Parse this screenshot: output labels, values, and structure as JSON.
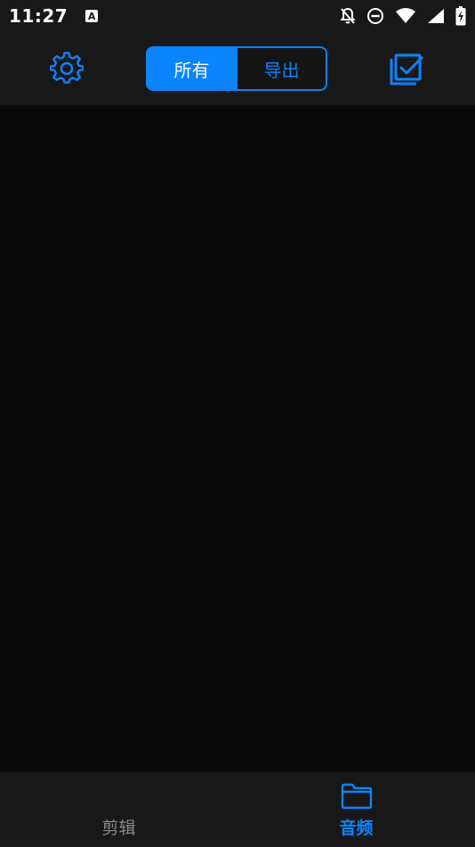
{
  "status_bar": {
    "time": "11:27",
    "app_badge": "A",
    "icons": [
      "notifications-off-icon",
      "do-not-disturb-icon",
      "wifi-icon",
      "signal-icon",
      "battery-charging-icon"
    ]
  },
  "header": {
    "settings_icon": "gear-icon",
    "select_icon": "multi-select-check-icon",
    "segments": [
      {
        "label": "所有",
        "active": true
      },
      {
        "label": "导出",
        "active": false
      }
    ]
  },
  "bottom_nav": {
    "items": [
      {
        "label": "剪辑",
        "active": false
      },
      {
        "label": "音频",
        "active": true,
        "icon": "folder-icon"
      }
    ]
  },
  "colors": {
    "accent": "#0a84ff",
    "background": "#0a0a0a",
    "bar_background": "#181818",
    "inactive_text": "#8a8a8a"
  }
}
